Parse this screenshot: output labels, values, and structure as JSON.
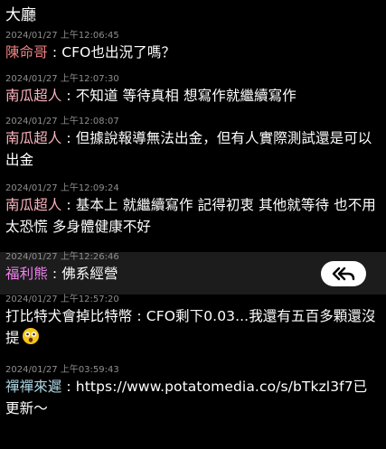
{
  "header": {
    "title": "大廳"
  },
  "colors": {
    "background": "#000000",
    "highlight_row": "#1c1c1c",
    "timestamp": "#8f8f8f",
    "message_text": "#ffffff",
    "reply_button_bg": "#ffffff",
    "reply_icon": "#000000"
  },
  "messages": [
    {
      "timestamp": "2024/01/27 上午12:06:45",
      "user": "陳命哥",
      "user_color": "#f08080",
      "separator": " : ",
      "text": "CFO也出況了嗎？"
    },
    {
      "timestamp": "2024/01/27 上午12:07:30",
      "user": "南瓜超人",
      "user_color": "#ffb6c1",
      "separator": " : ",
      "text": "不知道 等待真相 想寫作就繼續寫作"
    },
    {
      "timestamp": "2024/01/27 上午12:08:07",
      "user": "南瓜超人",
      "user_color": "#ffb6c1",
      "separator": " : ",
      "text": "但據說報導無法出金，但有人實際測試還是可以出金"
    },
    {
      "timestamp": "2024/01/27 上午12:09:24",
      "user": "南瓜超人",
      "user_color": "#ffb6c1",
      "separator": " : ",
      "text": "基本上 就繼續寫作 記得初衷 其他就等待 也不用太恐慌 多身體健康不好"
    },
    {
      "timestamp": "2024/01/27 上午12:26:46",
      "user": "福利熊",
      "user_color": "#ee82ee",
      "separator": " : ",
      "text": "佛系經營",
      "reply_icon": "reply-all-icon"
    },
    {
      "timestamp": "2024/01/27 上午12:57:20",
      "user": "",
      "user_color": "#ffffff",
      "separator": "",
      "text": "打比特犬會掉比特幣 : CFO剩下0.03...我還有五百多顆還沒提",
      "emoji": "astonished-face-emoji"
    },
    {
      "timestamp": "2024/01/27 上午03:59:43",
      "user": "禪禪來遲",
      "user_color": "#add8e6",
      "separator": " : ",
      "text": "https://www.potatomedia.co/s/bTkzl3f7已更新～"
    }
  ]
}
